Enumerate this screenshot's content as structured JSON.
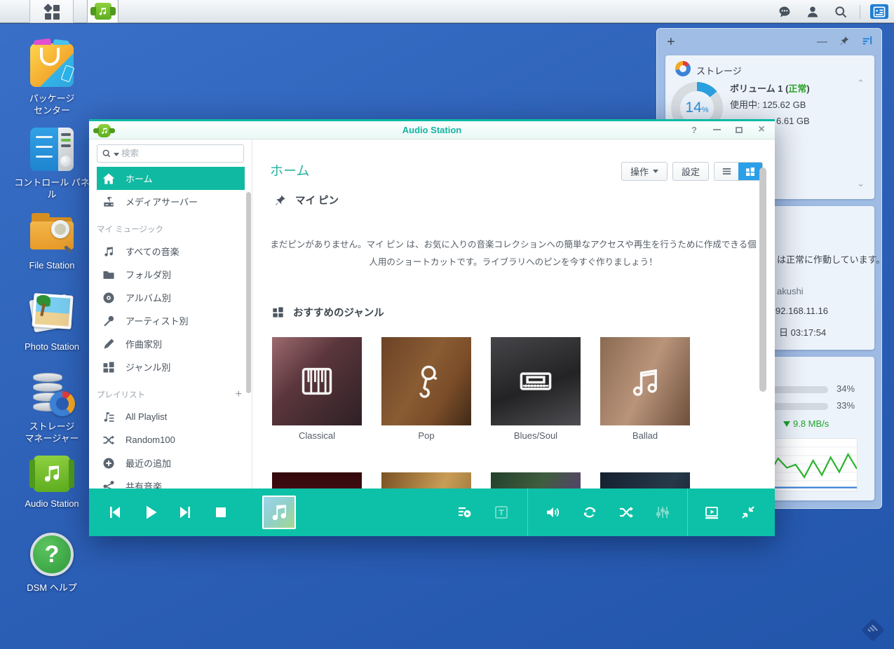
{
  "desktop": {
    "icons": [
      {
        "line1": "パッケージ",
        "line2": "センター"
      },
      {
        "line1": "コントロール パネル",
        "line2": ""
      },
      {
        "line1": "File Station",
        "line2": ""
      },
      {
        "line1": "Photo Station",
        "line2": ""
      },
      {
        "line1": "ストレージ",
        "line2": "マネージャー"
      },
      {
        "line1": "Audio Station",
        "line2": ""
      },
      {
        "line1": "DSM ヘルプ",
        "line2": ""
      }
    ]
  },
  "widgets": {
    "storage": {
      "title": "ストレージ",
      "percent": "14",
      "percent_sign": "%",
      "volume_prefix": "ボリューム 1 (",
      "volume_status": "正常",
      "volume_suffix": ")",
      "used": "使用中: 125.62 GB",
      "total_fragment": "6.61 GB"
    },
    "system": {
      "frag1": "は正常に作動しています。",
      "frag2": "akushi",
      "frag3": "92.168.11.16",
      "frag4": "日 03:17:54"
    },
    "resource": {
      "cpu_pct": "34%",
      "ram_pct": "33%",
      "down_speed": "9.8 MB/s",
      "spark_green": [
        30,
        58,
        40,
        52,
        53,
        52,
        52,
        51,
        51,
        70,
        42,
        66,
        38,
        56,
        50,
        74,
        42,
        70,
        36,
        64,
        30,
        58
      ],
      "spark_blue": 0.94
    }
  },
  "window": {
    "title": "Audio Station",
    "help_glyph": "?",
    "close_glyph": "×",
    "search_placeholder": "検索",
    "sidebar": {
      "home": "ホーム",
      "media_server": "メディアサーバー",
      "section_music": "マイ ミュージック",
      "music_items": [
        {
          "label": "すべての音楽"
        },
        {
          "label": "フォルダ別"
        },
        {
          "label": "アルバム別"
        },
        {
          "label": "アーティスト別"
        },
        {
          "label": "作曲家別"
        },
        {
          "label": "ジャンル別"
        }
      ],
      "section_playlist": "プレイリスト",
      "playlist_add": "+",
      "playlist_items": [
        {
          "label": "All Playlist"
        },
        {
          "label": "Random100"
        },
        {
          "label": "最近の追加"
        },
        {
          "label": "共有音楽"
        }
      ]
    },
    "toolbar": {
      "action": "操作",
      "settings": "設定"
    },
    "main": {
      "heading": "ホーム",
      "pin_title": "マイ ピン",
      "pin_text": "まだピンがありません。マイ ピン は、お気に入りの音楽コレクションへの簡単なアクセスや再生を行うために作成できる個人用のショートカットです。ライブラリへのピンを今すぐ作りましょう！",
      "genres_title": "おすすめのジャンル",
      "genres": [
        {
          "label": "Classical"
        },
        {
          "label": "Pop"
        },
        {
          "label": "Blues/Soul"
        },
        {
          "label": "Ballad"
        }
      ]
    }
  },
  "panel_header": {
    "add": "+"
  }
}
